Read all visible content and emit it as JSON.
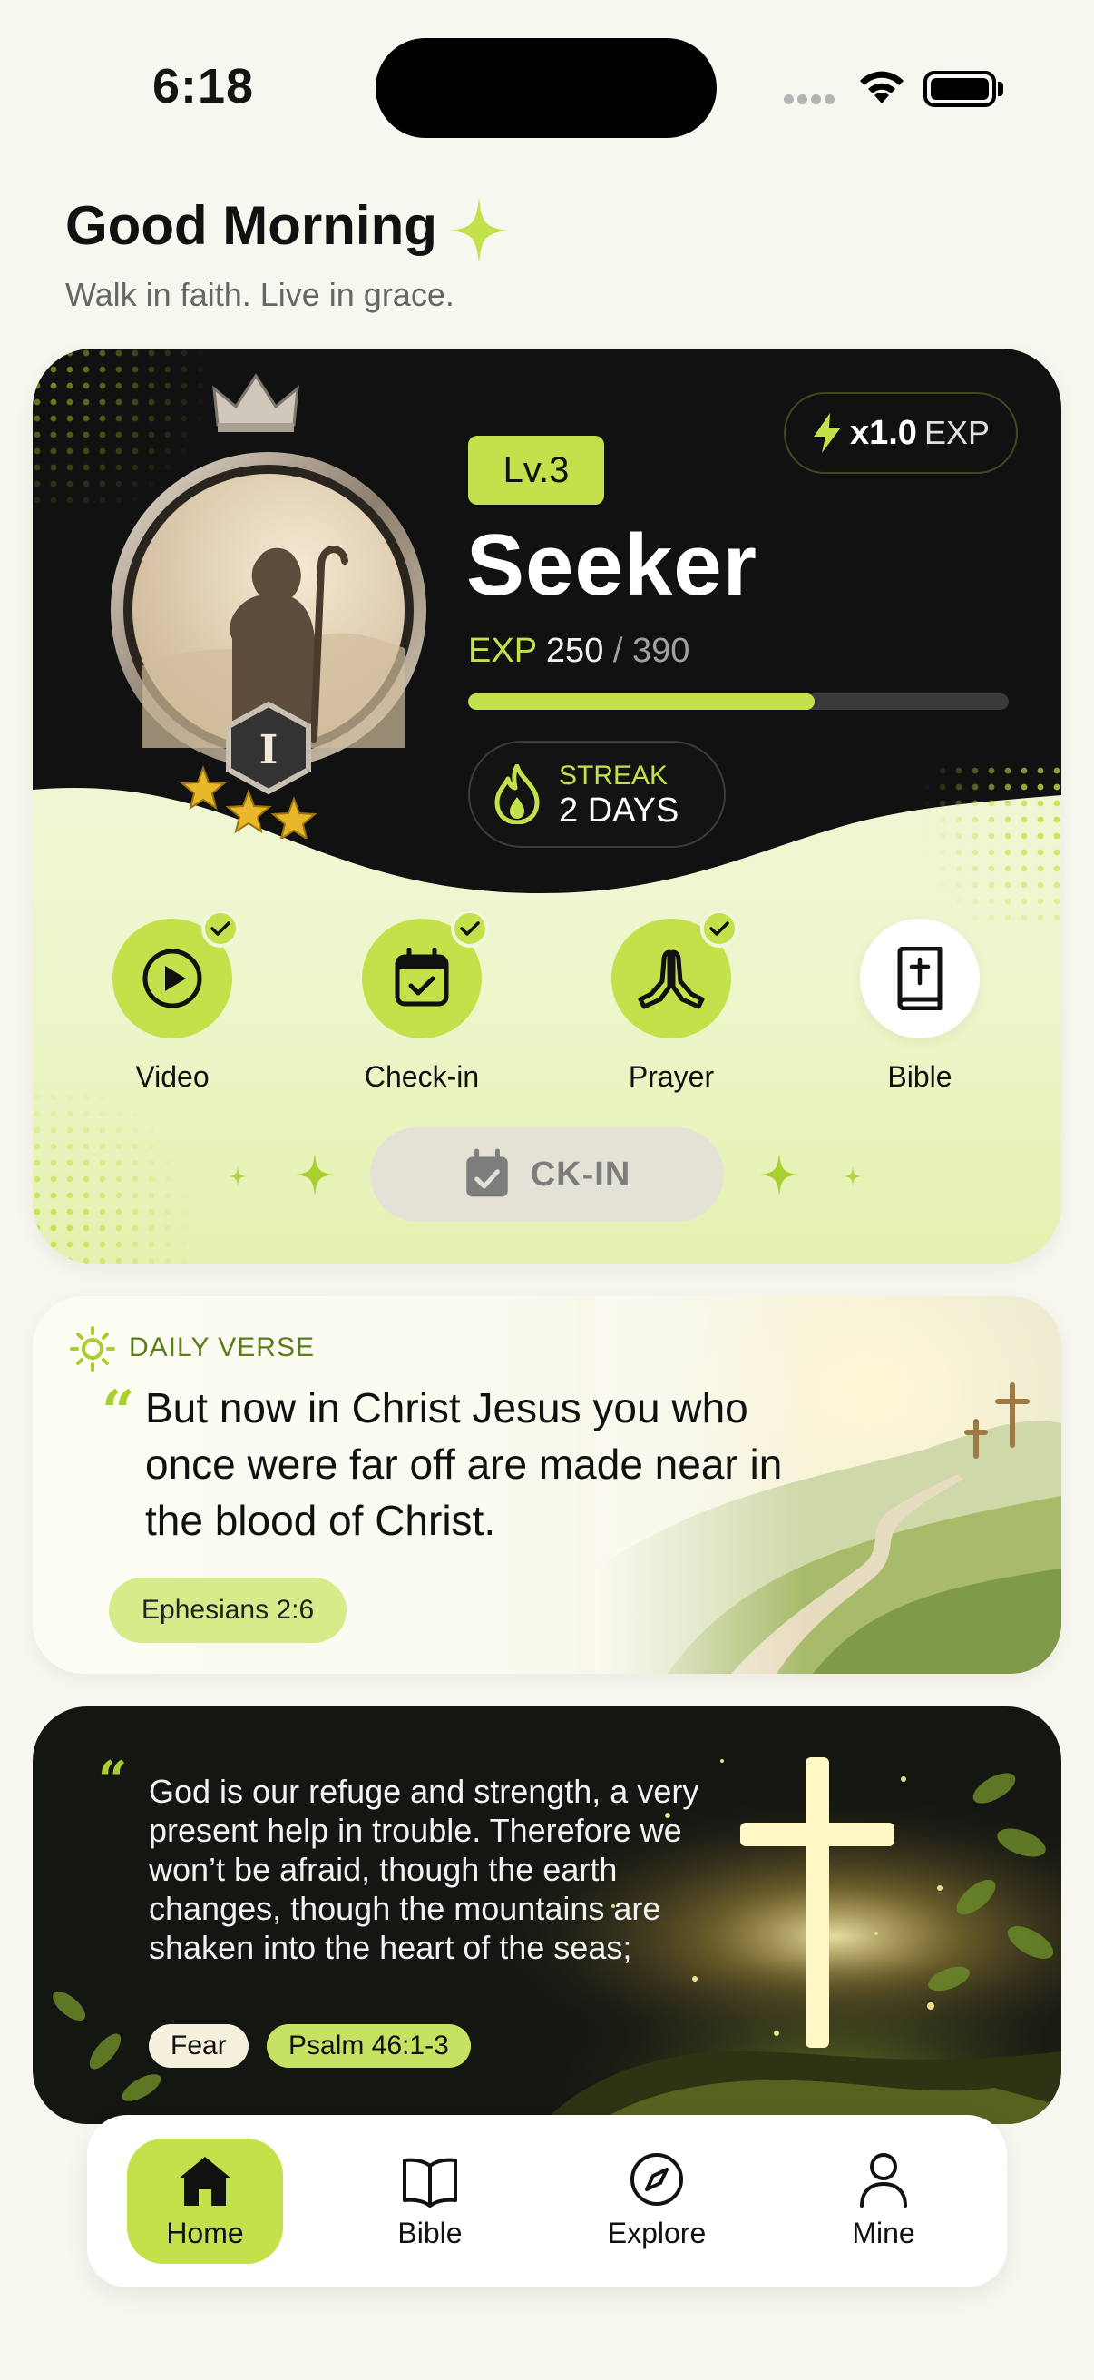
{
  "status_bar": {
    "time": "6:18"
  },
  "header": {
    "greeting": "Good Morning",
    "subtitle": "Walk in faith. Live in grace."
  },
  "level_card": {
    "level_label": "Lv.3",
    "rank_name": "Seeker",
    "rank_numeral": "I",
    "stars": 3,
    "exp_label": "EXP",
    "exp_current": "250",
    "exp_max": "/ 390",
    "exp_progress": 0.641,
    "multiplier": "x1.0",
    "multiplier_unit": "EXP",
    "streak_label": "STREAK",
    "streak_value": "2 DAYS",
    "tasks": [
      {
        "label": "Video",
        "done": true,
        "icon": "play-circle-icon"
      },
      {
        "label": "Check-in",
        "done": true,
        "icon": "calendar-check-icon"
      },
      {
        "label": "Prayer",
        "done": true,
        "icon": "praying-hands-icon"
      },
      {
        "label": "Bible",
        "done": false,
        "icon": "bible-book-icon"
      }
    ],
    "checkin_button_label": "CK-IN"
  },
  "daily_verse": {
    "label": "DAILY VERSE",
    "quote_mark": "“",
    "text": "But now in Christ Jesus you who once were far off are made near in the blood of Christ.",
    "reference": "Ephesians 2:6"
  },
  "featured_verse": {
    "quote_mark": "“",
    "text": "God is our refuge and strength, a very present help in trouble. Therefore we won’t be afraid, though the earth changes, though the mountains are shaken into the heart of the seas;",
    "tag": "Fear",
    "reference": "Psalm 46:1-3"
  },
  "bottom_nav": {
    "items": [
      {
        "label": "Home",
        "icon": "home-icon",
        "active": true
      },
      {
        "label": "Bible",
        "icon": "open-book-icon",
        "active": false
      },
      {
        "label": "Explore",
        "icon": "compass-icon",
        "active": false
      },
      {
        "label": "Mine",
        "icon": "user-icon",
        "active": false
      }
    ]
  },
  "colors": {
    "accent": "#c3e14a",
    "dark": "#111111",
    "background": "#f7f7f0"
  }
}
